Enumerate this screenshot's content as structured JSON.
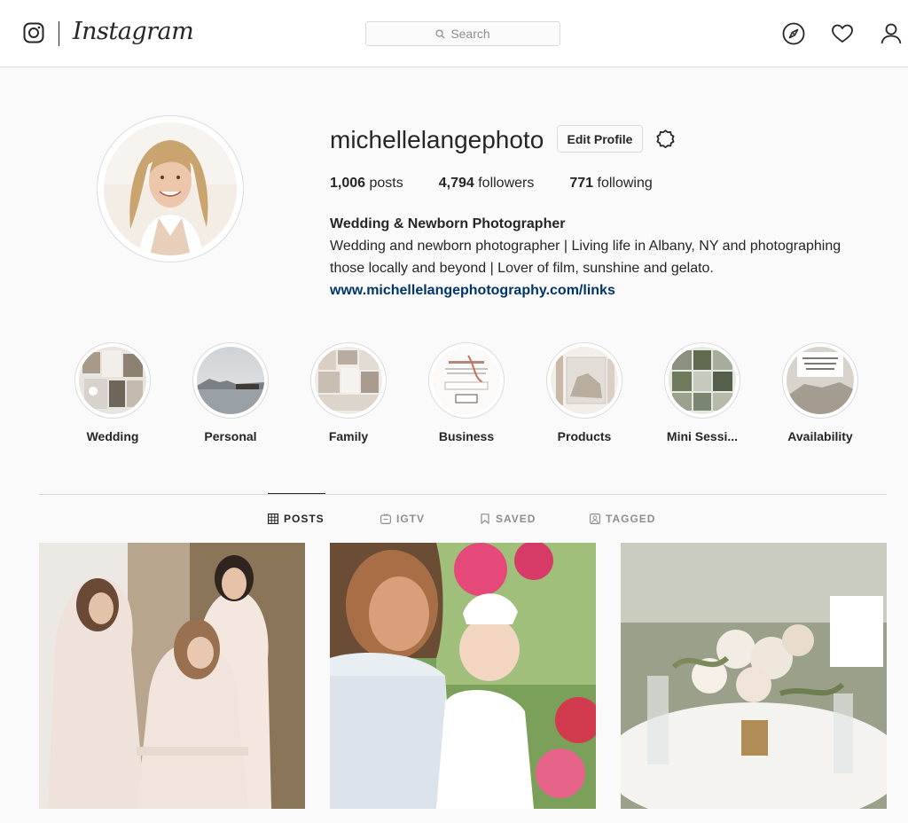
{
  "header": {
    "wordmark": "Instagram",
    "search_placeholder": "Search",
    "icons": [
      "instagram-glyph-icon",
      "search-icon",
      "explore-compass-icon",
      "heart-icon",
      "profile-icon"
    ]
  },
  "profile": {
    "username": "michellelangephoto",
    "edit_label": "Edit Profile",
    "posts_count": "1,006",
    "posts_label": " posts",
    "followers_count": "4,794",
    "followers_label": " followers",
    "following_count": "771",
    "following_label": " following",
    "full_name": "Wedding & Newborn Photographer",
    "bio_line1": "Wedding and newborn photographer | Living life in Albany, NY and photographing",
    "bio_line2": "those locally and beyond | Lover of film, sunshine and gelato.",
    "link": "www.michellelangephotography.com/links"
  },
  "highlights": [
    {
      "label": "Wedding"
    },
    {
      "label": "Personal"
    },
    {
      "label": "Family"
    },
    {
      "label": "Business"
    },
    {
      "label": "Products"
    },
    {
      "label": "Mini Sessi..."
    },
    {
      "label": "Availability"
    }
  ],
  "tabs": [
    {
      "label": "POSTS",
      "active": true
    },
    {
      "label": "IGTV",
      "active": false
    },
    {
      "label": "SAVED",
      "active": false
    },
    {
      "label": "TAGGED",
      "active": false
    }
  ],
  "colors": {
    "link": "#003569",
    "border": "#dbdbdb",
    "background": "#fafafa",
    "text": "#262626",
    "muted": "#8e8e8e"
  }
}
